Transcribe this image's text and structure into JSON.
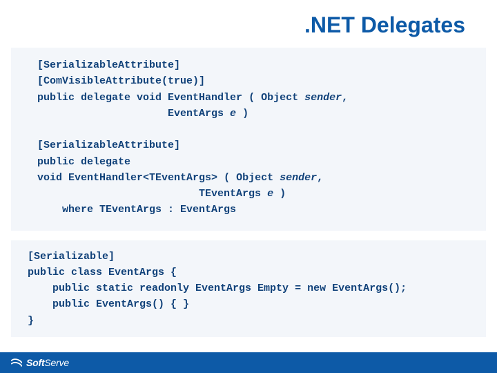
{
  "title": ".NET Delegates",
  "code1": {
    "l1": "[SerializableAttribute]",
    "l2": "[ComVisibleAttribute(true)]",
    "l3a": "public delegate void ",
    "l3b": "EventHandler",
    "l3c": " ( Object ",
    "l3d": "sender",
    "l3e": ",",
    "l4a": "                     EventArgs ",
    "l4b": "e",
    "l4c": " )",
    "blank": "",
    "l5": "[SerializableAttribute]",
    "l6": "public delegate",
    "l7a": "void ",
    "l7b": "EventHandler<TEventArgs>",
    "l7c": " ( Object ",
    "l7d": "sender",
    "l7e": ",",
    "l8a": "                          TEventArgs ",
    "l8b": "e",
    "l8c": " )",
    "l9": "    where TEventArgs : EventArgs"
  },
  "code2": {
    "l1": "[Serializable]",
    "l2": "public class EventArgs {",
    "l3": "    public static readonly EventArgs Empty = new EventArgs();",
    "l4": "    public EventArgs() { }",
    "l5": "}"
  },
  "footer": {
    "brand1": "Soft",
    "brand2": "Serve"
  }
}
